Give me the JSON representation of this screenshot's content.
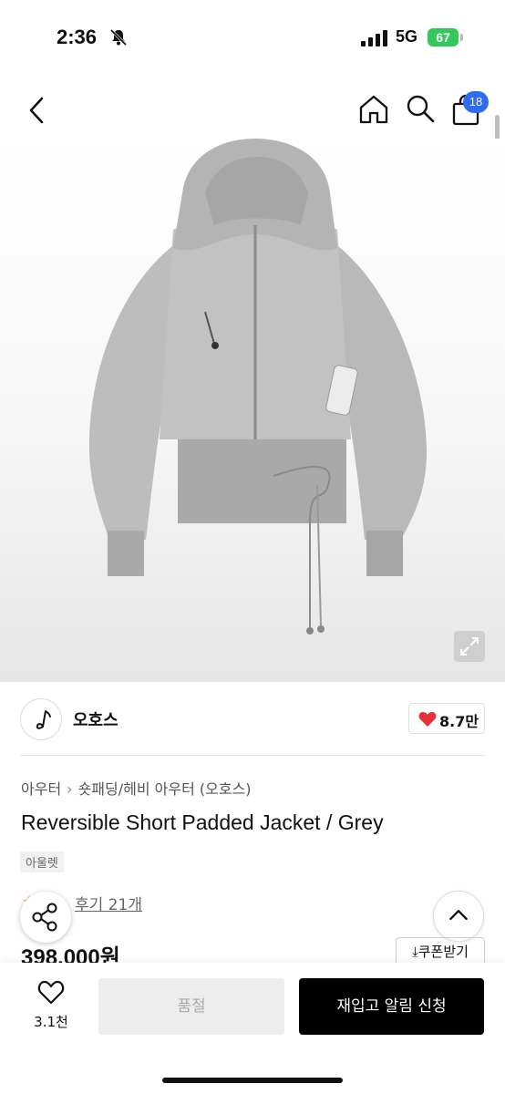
{
  "status_bar": {
    "time": "2:36",
    "network": "5G",
    "battery": "67"
  },
  "nav": {
    "cart_badge": "18"
  },
  "brand": {
    "name": "오호스",
    "likes": "8.7만"
  },
  "breadcrumb": [
    "아우터",
    "숏패딩/헤비 아우터 (오호스)"
  ],
  "product": {
    "title": "Reversible Short Padded Jacket / Grey",
    "tag": "아울렛",
    "review_text": "후기 21개",
    "price": "398,000원",
    "coupon_label": "쿠폰받기"
  },
  "bottom_bar": {
    "wish_count": "3.1천",
    "soldout_label": "품절",
    "restock_label": "재입고 알림 신청"
  },
  "icons": [
    "bell-off-icon",
    "signal-icon",
    "back-icon",
    "home-icon",
    "search-icon",
    "bag-icon",
    "expand-icon",
    "heart-icon",
    "share-icon",
    "chevron-up-icon",
    "download-icon",
    "heart-outline-icon"
  ],
  "colors": {
    "accent_blue": "#2f6bf0",
    "like_red": "#e8303a",
    "battery_green": "#34c759",
    "cta_black": "#000000"
  }
}
